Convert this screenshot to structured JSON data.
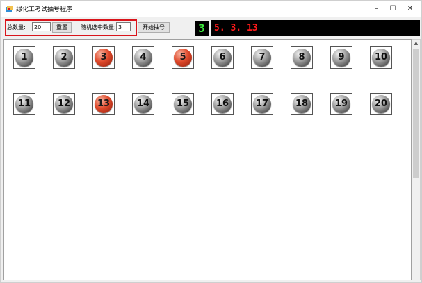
{
  "window": {
    "title": "绿化工考试抽号程序",
    "minimize": "–",
    "maximize": "☐",
    "close": "✕"
  },
  "toolbar": {
    "total_label": "总数量:",
    "total_value": "20",
    "reset_label": "重置",
    "pick_label": "随机选中数量:",
    "pick_value": "3",
    "start_label": "开始抽号"
  },
  "display": {
    "count": "3",
    "result": "5. 3. 13"
  },
  "numbers": [
    {
      "label": "1",
      "selected": false
    },
    {
      "label": "2",
      "selected": false
    },
    {
      "label": "3",
      "selected": true
    },
    {
      "label": "4",
      "selected": false
    },
    {
      "label": "5",
      "selected": true
    },
    {
      "label": "6",
      "selected": false
    },
    {
      "label": "7",
      "selected": false
    },
    {
      "label": "8",
      "selected": false
    },
    {
      "label": "9",
      "selected": false
    },
    {
      "label": "10",
      "selected": false
    },
    {
      "label": "11",
      "selected": false
    },
    {
      "label": "12",
      "selected": false
    },
    {
      "label": "13",
      "selected": true
    },
    {
      "label": "14",
      "selected": false
    },
    {
      "label": "15",
      "selected": false
    },
    {
      "label": "16",
      "selected": false
    },
    {
      "label": "17",
      "selected": false
    },
    {
      "label": "18",
      "selected": false
    },
    {
      "label": "19",
      "selected": false
    },
    {
      "label": "20",
      "selected": false
    }
  ],
  "colors": {
    "highlight_border": "#d9141b",
    "count_color": "#3ee83e",
    "result_color": "#ff1a1a",
    "selected_ball": "#e04a2c"
  }
}
